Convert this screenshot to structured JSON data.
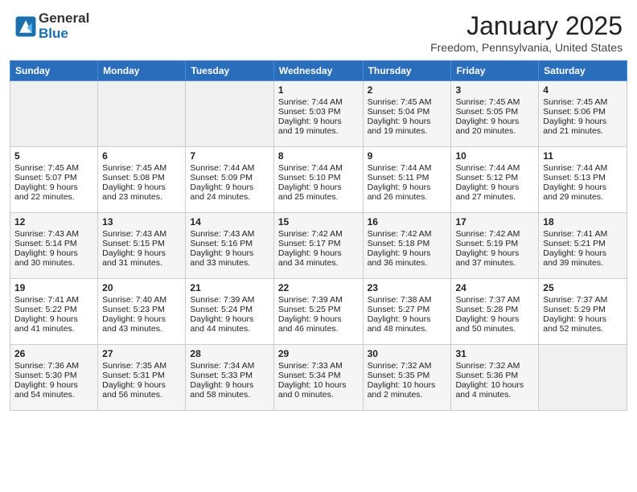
{
  "header": {
    "logo_general": "General",
    "logo_blue": "Blue",
    "title": "January 2025",
    "location": "Freedom, Pennsylvania, United States"
  },
  "days_of_week": [
    "Sunday",
    "Monday",
    "Tuesday",
    "Wednesday",
    "Thursday",
    "Friday",
    "Saturday"
  ],
  "weeks": [
    [
      {
        "day": "",
        "info": ""
      },
      {
        "day": "",
        "info": ""
      },
      {
        "day": "",
        "info": ""
      },
      {
        "day": "1",
        "info": "Sunrise: 7:44 AM\nSunset: 5:03 PM\nDaylight: 9 hours\nand 19 minutes."
      },
      {
        "day": "2",
        "info": "Sunrise: 7:45 AM\nSunset: 5:04 PM\nDaylight: 9 hours\nand 19 minutes."
      },
      {
        "day": "3",
        "info": "Sunrise: 7:45 AM\nSunset: 5:05 PM\nDaylight: 9 hours\nand 20 minutes."
      },
      {
        "day": "4",
        "info": "Sunrise: 7:45 AM\nSunset: 5:06 PM\nDaylight: 9 hours\nand 21 minutes."
      }
    ],
    [
      {
        "day": "5",
        "info": "Sunrise: 7:45 AM\nSunset: 5:07 PM\nDaylight: 9 hours\nand 22 minutes."
      },
      {
        "day": "6",
        "info": "Sunrise: 7:45 AM\nSunset: 5:08 PM\nDaylight: 9 hours\nand 23 minutes."
      },
      {
        "day": "7",
        "info": "Sunrise: 7:44 AM\nSunset: 5:09 PM\nDaylight: 9 hours\nand 24 minutes."
      },
      {
        "day": "8",
        "info": "Sunrise: 7:44 AM\nSunset: 5:10 PM\nDaylight: 9 hours\nand 25 minutes."
      },
      {
        "day": "9",
        "info": "Sunrise: 7:44 AM\nSunset: 5:11 PM\nDaylight: 9 hours\nand 26 minutes."
      },
      {
        "day": "10",
        "info": "Sunrise: 7:44 AM\nSunset: 5:12 PM\nDaylight: 9 hours\nand 27 minutes."
      },
      {
        "day": "11",
        "info": "Sunrise: 7:44 AM\nSunset: 5:13 PM\nDaylight: 9 hours\nand 29 minutes."
      }
    ],
    [
      {
        "day": "12",
        "info": "Sunrise: 7:43 AM\nSunset: 5:14 PM\nDaylight: 9 hours\nand 30 minutes."
      },
      {
        "day": "13",
        "info": "Sunrise: 7:43 AM\nSunset: 5:15 PM\nDaylight: 9 hours\nand 31 minutes."
      },
      {
        "day": "14",
        "info": "Sunrise: 7:43 AM\nSunset: 5:16 PM\nDaylight: 9 hours\nand 33 minutes."
      },
      {
        "day": "15",
        "info": "Sunrise: 7:42 AM\nSunset: 5:17 PM\nDaylight: 9 hours\nand 34 minutes."
      },
      {
        "day": "16",
        "info": "Sunrise: 7:42 AM\nSunset: 5:18 PM\nDaylight: 9 hours\nand 36 minutes."
      },
      {
        "day": "17",
        "info": "Sunrise: 7:42 AM\nSunset: 5:19 PM\nDaylight: 9 hours\nand 37 minutes."
      },
      {
        "day": "18",
        "info": "Sunrise: 7:41 AM\nSunset: 5:21 PM\nDaylight: 9 hours\nand 39 minutes."
      }
    ],
    [
      {
        "day": "19",
        "info": "Sunrise: 7:41 AM\nSunset: 5:22 PM\nDaylight: 9 hours\nand 41 minutes."
      },
      {
        "day": "20",
        "info": "Sunrise: 7:40 AM\nSunset: 5:23 PM\nDaylight: 9 hours\nand 43 minutes."
      },
      {
        "day": "21",
        "info": "Sunrise: 7:39 AM\nSunset: 5:24 PM\nDaylight: 9 hours\nand 44 minutes."
      },
      {
        "day": "22",
        "info": "Sunrise: 7:39 AM\nSunset: 5:25 PM\nDaylight: 9 hours\nand 46 minutes."
      },
      {
        "day": "23",
        "info": "Sunrise: 7:38 AM\nSunset: 5:27 PM\nDaylight: 9 hours\nand 48 minutes."
      },
      {
        "day": "24",
        "info": "Sunrise: 7:37 AM\nSunset: 5:28 PM\nDaylight: 9 hours\nand 50 minutes."
      },
      {
        "day": "25",
        "info": "Sunrise: 7:37 AM\nSunset: 5:29 PM\nDaylight: 9 hours\nand 52 minutes."
      }
    ],
    [
      {
        "day": "26",
        "info": "Sunrise: 7:36 AM\nSunset: 5:30 PM\nDaylight: 9 hours\nand 54 minutes."
      },
      {
        "day": "27",
        "info": "Sunrise: 7:35 AM\nSunset: 5:31 PM\nDaylight: 9 hours\nand 56 minutes."
      },
      {
        "day": "28",
        "info": "Sunrise: 7:34 AM\nSunset: 5:33 PM\nDaylight: 9 hours\nand 58 minutes."
      },
      {
        "day": "29",
        "info": "Sunrise: 7:33 AM\nSunset: 5:34 PM\nDaylight: 10 hours\nand 0 minutes."
      },
      {
        "day": "30",
        "info": "Sunrise: 7:32 AM\nSunset: 5:35 PM\nDaylight: 10 hours\nand 2 minutes."
      },
      {
        "day": "31",
        "info": "Sunrise: 7:32 AM\nSunset: 5:36 PM\nDaylight: 10 hours\nand 4 minutes."
      },
      {
        "day": "",
        "info": ""
      }
    ]
  ]
}
